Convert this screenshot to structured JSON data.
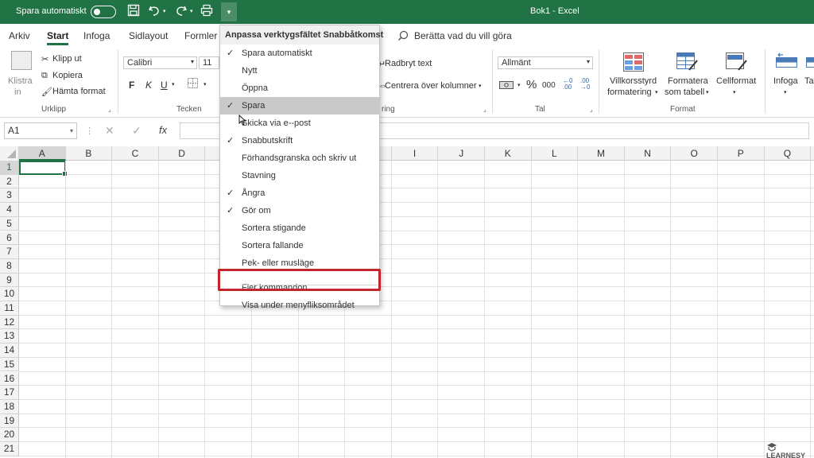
{
  "titlebar": {
    "autosave_label": "Spara automatiskt",
    "window_title": "Bok1  -  Excel",
    "more_glyph": "▾"
  },
  "tabs": [
    "Arkiv",
    "Start",
    "Infoga",
    "Sidlayout",
    "Formler"
  ],
  "tellme": "Berätta vad du vill göra",
  "ribbon": {
    "clipboard": {
      "paste": "Klistra",
      "paste_sub": "in",
      "cut": "Klipp ut",
      "copy": "Kopiera",
      "format_painter": "Hämta format",
      "group": "Urklipp"
    },
    "font": {
      "name": "Calibri",
      "size": "11",
      "bold": "F",
      "italic": "K",
      "underline": "U",
      "group": "Tecken"
    },
    "alignment": {
      "wrap": "Radbryt text",
      "merge": "Centrera över kolumner",
      "group_fragment": "ring"
    },
    "number": {
      "format": "Allmänt",
      "percent": "%",
      "comma": "000",
      "group": "Tal"
    },
    "styles": {
      "conditional": "Villkorsstyrd",
      "conditional_sub": "formatering",
      "as_table": "Formatera",
      "as_table_sub": "som tabell",
      "cell": "Cellformat",
      "group": "Format"
    },
    "cells": {
      "insert": "Infoga",
      "partial": "Ta"
    }
  },
  "formula_bar": {
    "name_box": "A1",
    "fx": "fx"
  },
  "columns": [
    "A",
    "B",
    "C",
    "D",
    "E",
    "F",
    "G",
    "H",
    "I",
    "J",
    "K",
    "L",
    "M",
    "N",
    "O",
    "P",
    "Q"
  ],
  "rows": [
    "1",
    "2",
    "3",
    "4",
    "5",
    "6",
    "7",
    "8",
    "9",
    "10",
    "11",
    "12",
    "13",
    "14",
    "15",
    "16",
    "17",
    "18",
    "19",
    "20",
    "21"
  ],
  "menu": {
    "title": "Anpassa verktygsfältet Snabbåtkomst",
    "items": [
      {
        "label": "Spara automatiskt",
        "checked": true
      },
      {
        "label": "Nytt",
        "checked": false
      },
      {
        "label": "Öppna",
        "checked": false
      },
      {
        "label": "Spara",
        "checked": true
      },
      {
        "label": "Skicka via e--post",
        "checked": false
      },
      {
        "label": "Snabbutskrift",
        "checked": true
      },
      {
        "label": "Förhandsgranska och skriv ut",
        "checked": false
      },
      {
        "label": "Stavning",
        "checked": false
      },
      {
        "label": "Ångra",
        "checked": true
      },
      {
        "label": "Gör om",
        "checked": true
      },
      {
        "label": "Sortera stigande",
        "checked": false
      },
      {
        "label": "Sortera fallande",
        "checked": false
      },
      {
        "label": "Pek- eller musläge",
        "checked": false
      },
      {
        "label": "Fler kommandon...",
        "checked": false
      },
      {
        "label": "Visa under menyfliksområdet",
        "checked": false
      }
    ],
    "check_glyph": "✓"
  },
  "logo_text": "LEARNESY"
}
